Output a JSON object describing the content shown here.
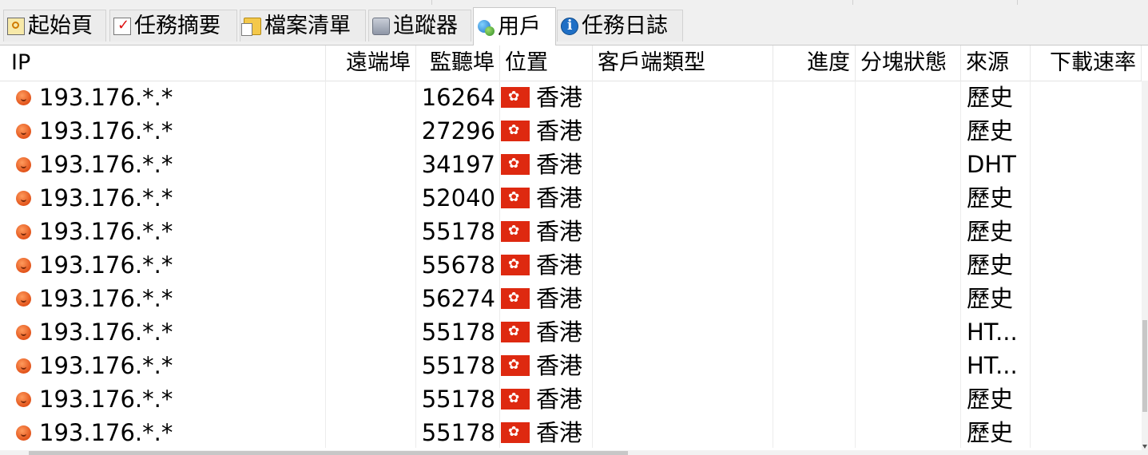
{
  "tabs": [
    {
      "label": "起始頁",
      "icon": "home-icon"
    },
    {
      "label": "任務摘要",
      "icon": "checklist-icon"
    },
    {
      "label": "檔案清單",
      "icon": "files-icon"
    },
    {
      "label": "追蹤器",
      "icon": "tracker-icon"
    },
    {
      "label": "用戶",
      "icon": "users-icon",
      "active": true
    },
    {
      "label": "任務日誌",
      "icon": "info-icon"
    }
  ],
  "columns": {
    "ip": "IP",
    "remote_port": "遠端埠",
    "listen_port": "監聽埠",
    "location": "位置",
    "client_type": "客戶端類型",
    "progress": "進度",
    "piece_state": "分塊狀態",
    "source": "來源",
    "download_speed": "下載速率"
  },
  "rows": [
    {
      "ip": "193.176.*.*",
      "listen_port": "16264",
      "location": "香港",
      "source": "歷史"
    },
    {
      "ip": "193.176.*.*",
      "listen_port": "27296",
      "location": "香港",
      "source": "歷史"
    },
    {
      "ip": "193.176.*.*",
      "listen_port": "34197",
      "location": "香港",
      "source": "DHT"
    },
    {
      "ip": "193.176.*.*",
      "listen_port": "52040",
      "location": "香港",
      "source": "歷史"
    },
    {
      "ip": "193.176.*.*",
      "listen_port": "55178",
      "location": "香港",
      "source": "歷史"
    },
    {
      "ip": "193.176.*.*",
      "listen_port": "55678",
      "location": "香港",
      "source": "歷史"
    },
    {
      "ip": "193.176.*.*",
      "listen_port": "56274",
      "location": "香港",
      "source": "歷史"
    },
    {
      "ip": "193.176.*.*",
      "listen_port": "55178",
      "location": "香港",
      "source": "HT..."
    },
    {
      "ip": "193.176.*.*",
      "listen_port": "55178",
      "location": "香港",
      "source": "HT..."
    },
    {
      "ip": "193.176.*.*",
      "listen_port": "55178",
      "location": "香港",
      "source": "歷史"
    },
    {
      "ip": "193.176.*.*",
      "listen_port": "55178",
      "location": "香港",
      "source": "歷史"
    }
  ]
}
